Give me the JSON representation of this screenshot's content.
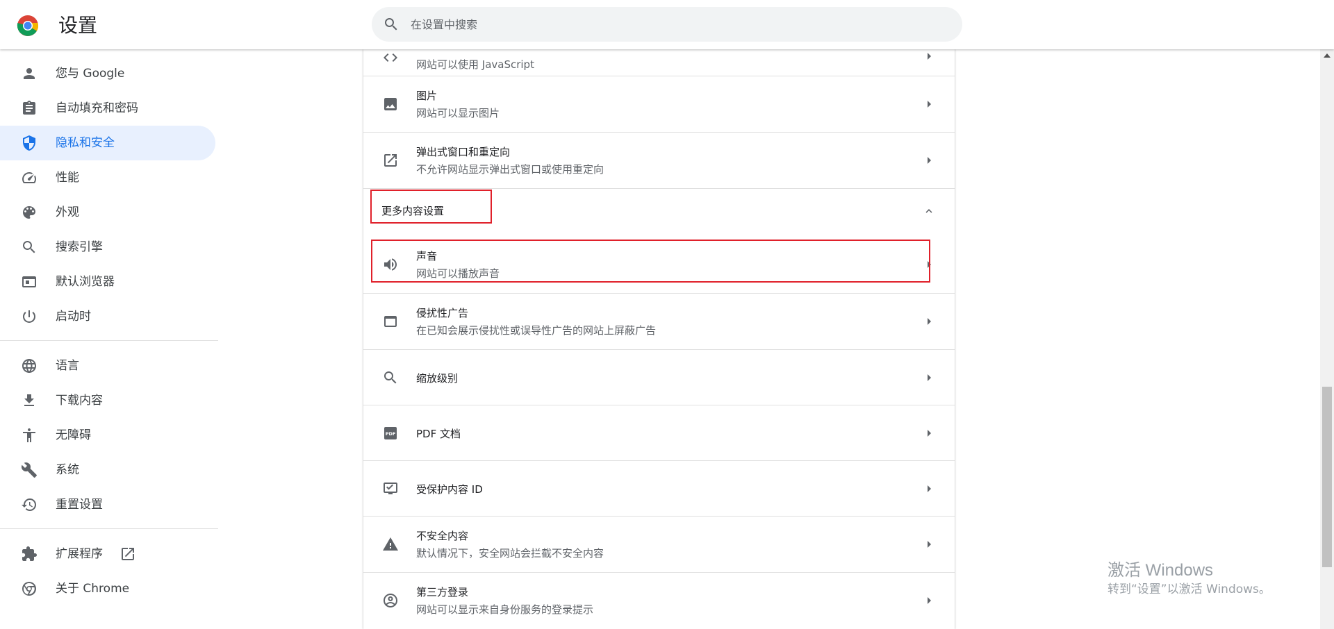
{
  "header": {
    "title": "设置",
    "search_placeholder": "在设置中搜索"
  },
  "colors": {
    "accent": "#1a73e8",
    "active_background": "#e8f0fe",
    "highlight_border": "#e0202a"
  },
  "sidebar": {
    "items": [
      {
        "label": "您与 Google",
        "icon": "person-icon",
        "active": false
      },
      {
        "label": "自动填充和密码",
        "icon": "clipboard-icon",
        "active": false
      },
      {
        "label": "隐私和安全",
        "icon": "shield-icon",
        "active": true
      },
      {
        "label": "性能",
        "icon": "speedometer-icon",
        "active": false
      },
      {
        "label": "外观",
        "icon": "palette-icon",
        "active": false
      },
      {
        "label": "搜索引擎",
        "icon": "search-icon",
        "active": false
      },
      {
        "label": "默认浏览器",
        "icon": "browser-window-icon",
        "active": false
      },
      {
        "label": "启动时",
        "icon": "power-icon",
        "active": false
      },
      {
        "label": "语言",
        "icon": "globe-icon",
        "active": false
      },
      {
        "label": "下载内容",
        "icon": "download-icon",
        "active": false
      },
      {
        "label": "无障碍",
        "icon": "accessibility-icon",
        "active": false
      },
      {
        "label": "系统",
        "icon": "wrench-icon",
        "active": false
      },
      {
        "label": "重置设置",
        "icon": "history-icon",
        "active": false
      },
      {
        "label": "扩展程序",
        "icon": "puzzle-icon",
        "active": false
      },
      {
        "label": "关于 Chrome",
        "icon": "chrome-icon",
        "active": false
      }
    ]
  },
  "content": {
    "partial_row": {
      "subtitle": "网站可以使用 JavaScript",
      "icon": "code-icon"
    },
    "rows_top": [
      {
        "title": "图片",
        "subtitle": "网站可以显示图片",
        "icon": "image-icon"
      },
      {
        "title": "弹出式窗口和重定向",
        "subtitle": "不允许网站显示弹出式窗口或使用重定向",
        "icon": "open-in-new-icon"
      }
    ],
    "section_title": "更多内容设置",
    "rows_more": [
      {
        "title": "声音",
        "subtitle": "网站可以播放声音",
        "icon": "volume-icon"
      },
      {
        "title": "侵扰性广告",
        "subtitle": "在已知会展示侵扰性或误导性广告的网站上屏蔽广告",
        "icon": "ad-window-icon"
      },
      {
        "title": "缩放级别",
        "subtitle": "",
        "icon": "zoom-icon"
      },
      {
        "title": "PDF 文档",
        "subtitle": "",
        "icon": "pdf-icon"
      },
      {
        "title": "受保护内容 ID",
        "subtitle": "",
        "icon": "protected-content-icon"
      },
      {
        "title": "不安全内容",
        "subtitle": "默认情况下，安全网站会拦截不安全内容",
        "icon": "warning-icon"
      },
      {
        "title": "第三方登录",
        "subtitle": "网站可以显示来自身份服务的登录提示",
        "icon": "account-circle-icon"
      }
    ]
  },
  "watermark": {
    "title": "激活 Windows",
    "subtitle": "转到“设置”以激活 Windows。"
  }
}
